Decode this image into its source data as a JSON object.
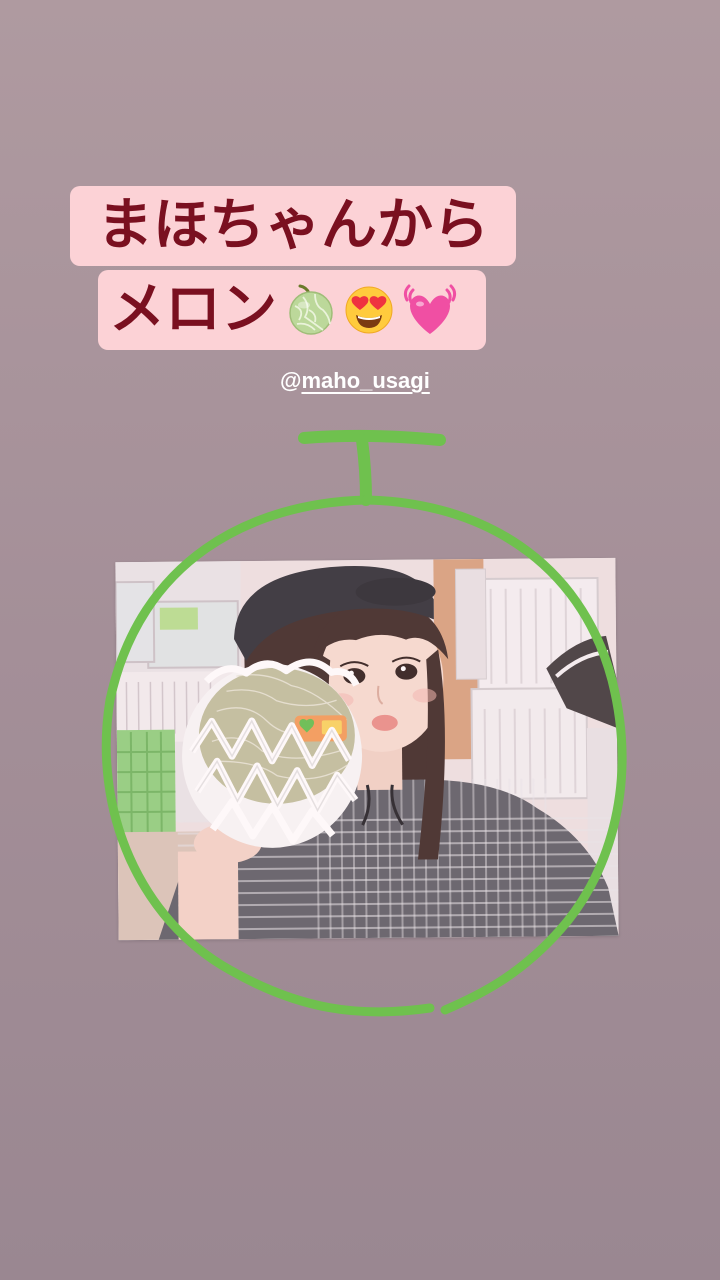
{
  "story": {
    "caption_line1": "まほちゃんから",
    "caption_line2": "メロン",
    "caption_emojis": [
      "melon-emoji",
      "heart-eyes-emoji",
      "beating-heart-emoji"
    ],
    "mention": {
      "at": "@",
      "handle": "maho_usagi"
    }
  },
  "colors": {
    "background_top": "#af9aa0",
    "background_bottom": "#9a8791",
    "caption_bg": "#fcd2d6",
    "caption_text": "#7a1020",
    "doodle_green": "#6fc14e",
    "mention_text": "#ffffff"
  },
  "icons": {
    "photo": "selfie-photo-with-melon",
    "doodle": "melon-outline-drawing"
  }
}
